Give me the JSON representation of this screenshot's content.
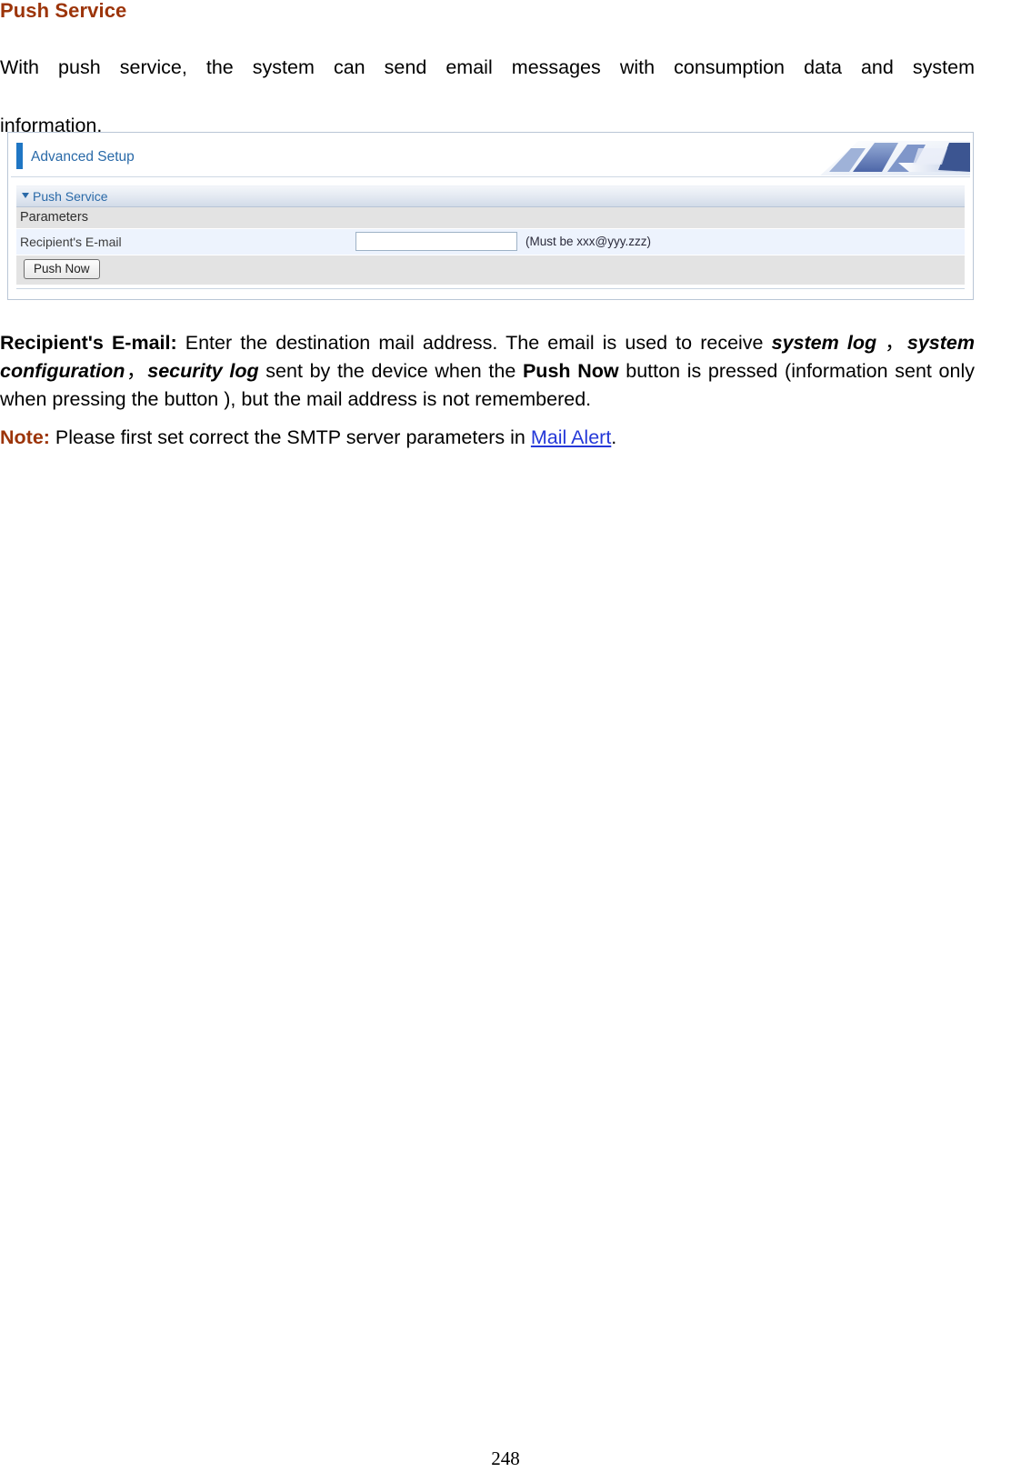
{
  "document": {
    "heading": "Push Service",
    "intro_line1": "With push service, the system can send email messages with consumption data and system",
    "intro_line2": "information.",
    "page_number": "248"
  },
  "router_ui": {
    "header_title": "Advanced Setup",
    "banner_icon": "computers-banner-image",
    "section_title": "Push Service",
    "caret_icon": "caret-down-icon",
    "rows": {
      "parameters_label": "Parameters",
      "email_label": "Recipient's E-mail",
      "email_value": "",
      "email_placeholder": "",
      "email_hint": "(Must be xxx@yyy.zzz)",
      "push_button_label": "Push Now"
    }
  },
  "description": {
    "term": "Recipient's E-mail:",
    "seg1": " Enter the destination mail address. The email is used to receive ",
    "em1": "system log",
    "comma1": " ，",
    "em2": "system configuration",
    "comma2": "，",
    "em3": "security log",
    "seg2": " sent by the device when the ",
    "em4": "Push Now",
    "seg3": " button is pressed (information sent only when pressing the button ), but the mail address is not remembered."
  },
  "note": {
    "label": "Note:",
    "text_before": " Please first set correct the SMTP server parameters in ",
    "link_text": "Mail Alert",
    "text_after": "."
  },
  "colors": {
    "heading": "#9c3409",
    "ui_accent_blue": "#1f76c4",
    "ui_text_blue": "#2a6aa8",
    "row_gray": "#e3e3e3",
    "row_blue": "#edf3fd",
    "link_blue": "#2438d8"
  }
}
